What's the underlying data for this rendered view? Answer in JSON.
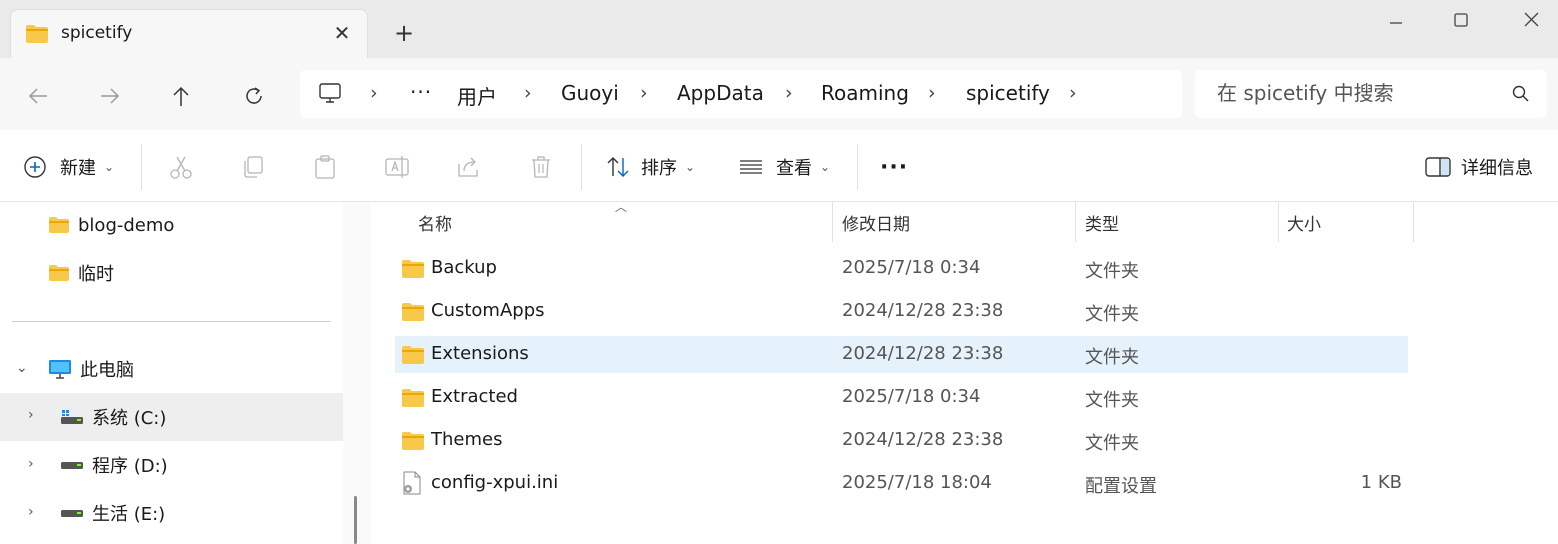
{
  "tab": {
    "title": "spicetify"
  },
  "breadcrumb": {
    "more": "···",
    "items": [
      "用户",
      "Guoyi",
      "AppData",
      "Roaming",
      "spicetify"
    ]
  },
  "search": {
    "placeholder": "在 spicetify 中搜索"
  },
  "toolbar": {
    "new_label": "新建",
    "sort_label": "排序",
    "view_label": "查看",
    "more_label": "···",
    "details_label": "详细信息"
  },
  "sidebar": {
    "quick_items": [
      "blog-demo",
      "临时"
    ],
    "this_pc": "此电脑",
    "drives": [
      "系统 (C:)",
      "程序 (D:)",
      "生活 (E:)"
    ]
  },
  "columns": {
    "name": "名称",
    "date": "修改日期",
    "type": "类型",
    "size": "大小"
  },
  "files": [
    {
      "name": "Backup",
      "date": "2025/7/18 0:34",
      "type": "文件夹",
      "size": "",
      "icon": "folder-icon"
    },
    {
      "name": "CustomApps",
      "date": "2024/12/28 23:38",
      "type": "文件夹",
      "size": "",
      "icon": "folder-icon"
    },
    {
      "name": "Extensions",
      "date": "2024/12/28 23:38",
      "type": "文件夹",
      "size": "",
      "icon": "folder-icon",
      "selected": true
    },
    {
      "name": "Extracted",
      "date": "2025/7/18 0:34",
      "type": "文件夹",
      "size": "",
      "icon": "folder-icon"
    },
    {
      "name": "Themes",
      "date": "2024/12/28 23:38",
      "type": "文件夹",
      "size": "",
      "icon": "folder-icon"
    },
    {
      "name": "config-xpui.ini",
      "date": "2025/7/18 18:04",
      "type": "配置设置",
      "size": "1 KB",
      "icon": "config-file-icon"
    }
  ],
  "colors": {
    "folder": "#f8c948",
    "folder_dark": "#e8a80a",
    "selection": "#e5f1fb",
    "accent": "#0067c0"
  }
}
